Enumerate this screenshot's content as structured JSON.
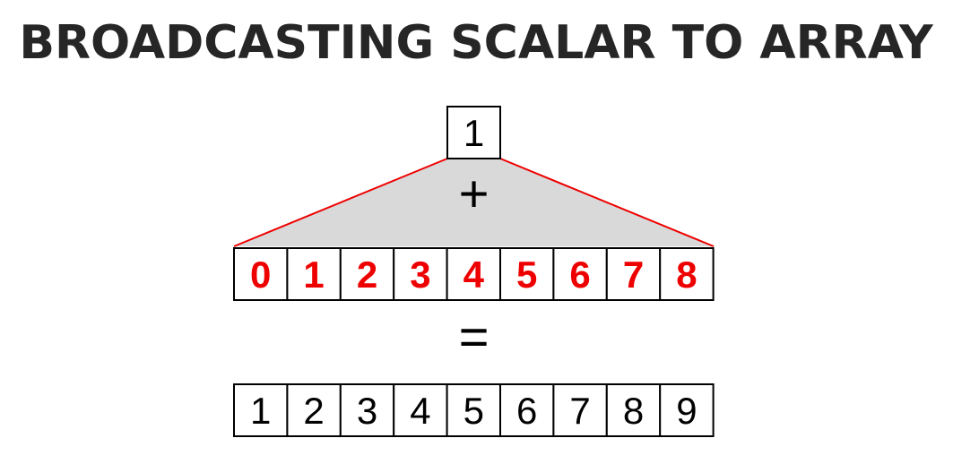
{
  "title": "BROADCASTING SCALAR TO ARRAY",
  "scalar": "1",
  "plus_operator": "+",
  "equals_operator": "=",
  "input_array": [
    "0",
    "1",
    "2",
    "3",
    "4",
    "5",
    "6",
    "7",
    "8"
  ],
  "result_array": [
    "1",
    "2",
    "3",
    "4",
    "5",
    "6",
    "7",
    "8",
    "9"
  ],
  "colors": {
    "title": "#262626",
    "input_text": "#ee0000",
    "broadcast_lines": "#ee0000",
    "broadcast_fill": "#d9d9d9",
    "cell_border": "#000000"
  }
}
